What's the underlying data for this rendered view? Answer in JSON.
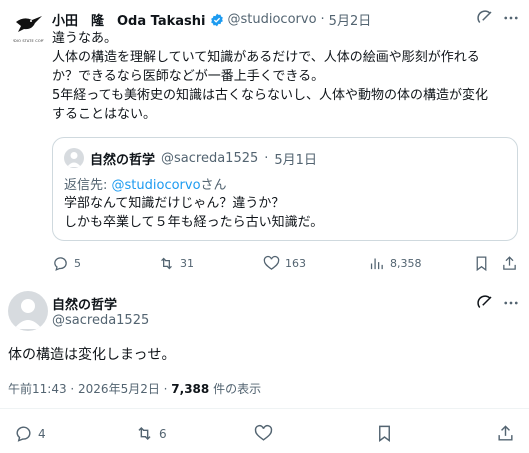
{
  "tweet1": {
    "name": "小田　隆　Oda Takashi",
    "handle": "@studiocorvo",
    "date": "5月2日",
    "avatar_text": "TUDIO STATE CORVI",
    "lines": [
      "違うなあ。",
      "人体の構造を理解していて知識があるだけで、人体の絵画や彫刻が作れる",
      "か？できるなら医師などが一番上手くできる。",
      "5年経っても美術史の知識は古くならないし、人体や動物の体の構造が変化",
      "することはない。"
    ],
    "quote": {
      "name": "自然の哲学",
      "handle": "@sacreda1525",
      "date": "5月1日",
      "reply_prefix": "返信先: ",
      "reply_handle": "@studiocorvo",
      "reply_suffix": "さん",
      "lines": [
        "学部なんて知識だけじゃん？違うか？",
        "しかも卒業して５年も経ったら古い知識だ。"
      ]
    },
    "actions": {
      "replies": "5",
      "retweets": "31",
      "likes": "163",
      "views": "8,358"
    }
  },
  "tweet2": {
    "name": "自然の哲学",
    "handle": "@sacreda1525",
    "text": "体の構造は変化しまっせ。",
    "timestamp": "午前11:43 · 2026年5月2日 · ",
    "view_count": "7,388",
    "view_suffix": " 件の表示",
    "actions": {
      "replies": "4",
      "retweets": "6"
    }
  },
  "colors": {
    "text": "#0f1419",
    "muted": "#536471",
    "verified": "#1d9bf0",
    "border": "#cfd9de"
  }
}
